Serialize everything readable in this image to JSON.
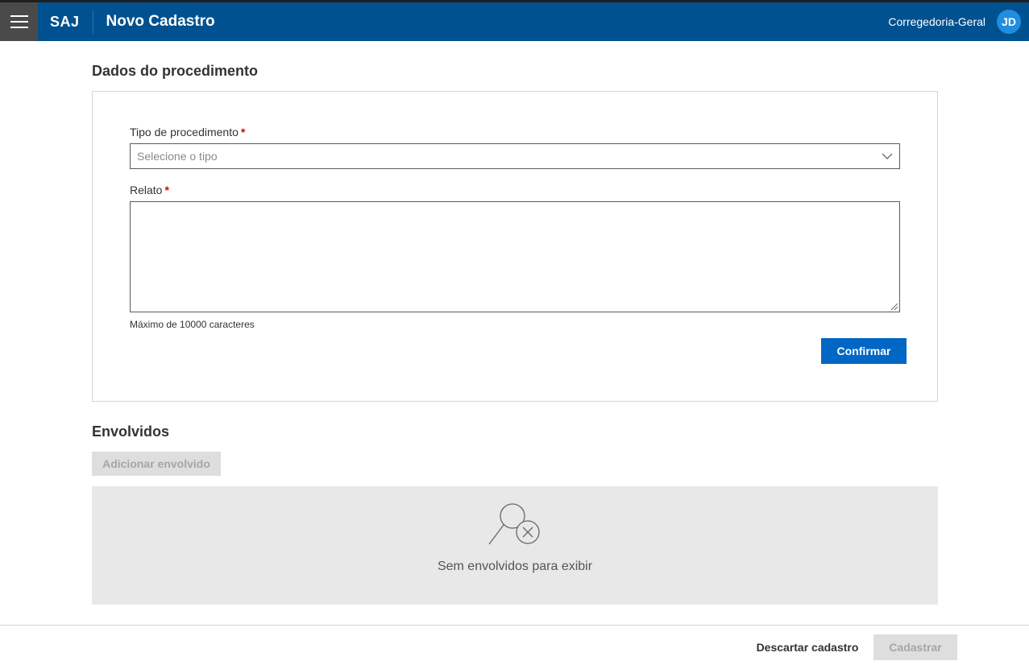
{
  "header": {
    "brand": "SAJ",
    "title": "Novo Cadastro",
    "org": "Corregedoria-Geral",
    "avatar_initials": "JD",
    "bg_color": "#00518f"
  },
  "procedimento": {
    "section_title": "Dados do procedimento",
    "tipo_label": "Tipo de procedimento",
    "tipo_placeholder": "Selecione o tipo",
    "relato_label": "Relato",
    "relato_value": "",
    "required_mark": "*",
    "hint": "Máximo de 10000 caracteres",
    "confirm_label": "Confirmar"
  },
  "envolvidos": {
    "section_title": "Envolvidos",
    "add_label": "Adicionar envolvido",
    "empty_text": "Sem envolvidos para exibir",
    "empty_icon": "search-not-found-icon"
  },
  "footer": {
    "discard_label": "Descartar cadastro",
    "submit_label": "Cadastrar"
  },
  "colors": {
    "primary": "#0067c5",
    "required": "#d0021b",
    "disabled_bg": "#dedede"
  }
}
